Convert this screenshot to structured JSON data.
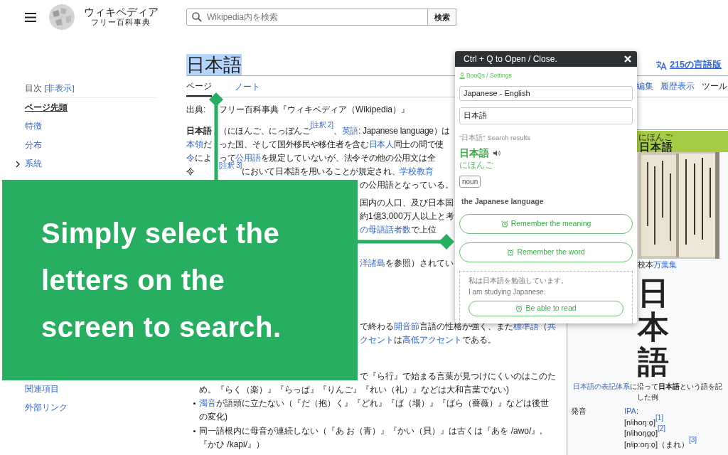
{
  "header": {
    "wordmark": "ウィキペディア",
    "tagline": "フリー百科事典",
    "search": {
      "placeholder": "Wikipedia内を検索"
    },
    "search_button": "検索"
  },
  "toc": {
    "title": "目次",
    "toggle": "[非表示]",
    "items": [
      {
        "label": "ページ先頭",
        "selected": true,
        "expandable": false
      },
      {
        "label": "特徴",
        "selected": false,
        "expandable": false
      },
      {
        "label": "分布",
        "selected": false,
        "expandable": false
      },
      {
        "label": "系統",
        "selected": false,
        "expandable": true
      }
    ],
    "more_items": [
      {
        "label": "関連項目",
        "selected": false,
        "expandable": false
      },
      {
        "label": "外部リンク",
        "selected": false,
        "expandable": false
      }
    ]
  },
  "article": {
    "title": "日本語",
    "title_highlighted": true,
    "languages": "215の言語版",
    "tabs": [
      {
        "label": "ページ",
        "selected": true
      },
      {
        "label": "ノート",
        "selected": false
      }
    ],
    "actions": [
      "編集",
      "履歴表示",
      "ツール"
    ],
    "source": {
      "left": "出典:",
      "right": "フリー百科事典『ウィキペディア（Wikipedia）』"
    },
    "intro_lines": [
      {
        "left": [
          {
            "text": "日本語",
            "kind": "bold"
          }
        ],
        "right": [
          {
            "text": "（にほんご、にっぽんご",
            "kind": "plain"
          },
          {
            "text": "[注釈 2]",
            "kind": "ref"
          },
          {
            "text": "、",
            "kind": "plain"
          },
          {
            "text": "英語",
            "kind": "link"
          },
          {
            "text": ": Japanese language）は",
            "kind": "plain"
          }
        ]
      },
      {
        "left": [
          {
            "text": "本領",
            "kind": "link"
          },
          {
            "text": "だ",
            "kind": "plain"
          }
        ],
        "right": [
          {
            "text": "った国、そして国外移民や移住者を含む",
            "kind": "plain"
          },
          {
            "text": "日本人",
            "kind": "link"
          },
          {
            "text": "同士の間で使",
            "kind": "plain"
          }
        ]
      },
      {
        "left": [
          {
            "text": "令",
            "kind": "link"
          },
          {
            "text": "によ",
            "kind": "plain"
          }
        ],
        "right": [
          {
            "text": "って",
            "kind": "plain"
          },
          {
            "text": "公用語",
            "kind": "link"
          },
          {
            "text": "を規定していないが、法令その他の公用文は全",
            "kind": "plain"
          }
        ]
      },
      {
        "left": [
          {
            "text": "令",
            "kind": "plain"
          }
        ],
        "right": [
          {
            "text": "[注釈 3]",
            "kind": "ref"
          },
          {
            "text": "において日本語を用いることが規定され、",
            "kind": "plain"
          },
          {
            "text": "学校教育",
            "kind": "link"
          }
        ]
      }
    ],
    "beside_paragraphs": [
      [
        [
          {
            "text": "の公用語となっている。",
            "kind": "plain"
          }
        ]
      ],
      [
        [
          {
            "text": "国内の人口、及び日本国",
            "kind": "plain"
          }
        ],
        [
          {
            "text": "約1億3,000万人以上と考",
            "kind": "plain"
          }
        ],
        [
          {
            "text": "の母語話者数",
            "kind": "link"
          },
          {
            "text": "で上位",
            "kind": "plain"
          }
        ]
      ],
      [
        [
          {
            "text": "洋諸島",
            "kind": "link"
          },
          {
            "text": "を参照）されてい",
            "kind": "plain"
          }
        ]
      ]
    ],
    "below_lines": [
      [
        {
          "text": "で終わる",
          "kind": "plain"
        },
        {
          "text": "開音節",
          "kind": "link"
        },
        {
          "text": "言語の性格が強く、また",
          "kind": "plain"
        },
        {
          "text": "標準語",
          "kind": "link"
        },
        {
          "text": "（",
          "kind": "plain"
        },
        {
          "text": "共",
          "kind": "link"
        }
      ],
      [
        {
          "text": "クセント",
          "kind": "link"
        },
        {
          "text": "は",
          "kind": "plain"
        },
        {
          "text": "高低アクセント",
          "kind": "link"
        },
        {
          "text": "である。",
          "kind": "plain"
        }
      ]
    ],
    "list_fragment": {
      "beside": [
        {
          "text": "で『ら行』で始まる言葉が見つけにくいのはこのた",
          "kind": "plain"
        }
      ],
      "rest": [
        {
          "text": "め。『らく（楽）』『らっぱ』『りんご』『れい（礼）』などは大和言葉でない)",
          "kind": "plain"
        }
      ]
    },
    "list_items": [
      [
        {
          "text": "濁音",
          "kind": "link"
        },
        {
          "text": "が語頭に立たない（『だ（抱）く』『どれ』『ば（場）』『ばら（薔薇）』などは後世の変化)",
          "kind": "plain"
        }
      ],
      [
        {
          "text": "同一語根内に母音が連続しない（『あ お（青）』『かい（貝）』は古くは『あを /awo/』, 『かひ /kapi/』）",
          "kind": "plain"
        }
      ]
    ]
  },
  "infobox": {
    "title": "日本語",
    "reading": "にほんご",
    "kind": "picture",
    "picture_caption": [
      {
        "text": "校本",
        "kind": "plain"
      },
      {
        "text": "万葉集",
        "kind": "link"
      }
    ],
    "calligraphy": "日本語",
    "caption_lines": [
      [
        {
          "text": "日本語の表記体系",
          "kind": "link"
        },
        {
          "text": "に沿って",
          "kind": "plain"
        },
        {
          "text": "日本語",
          "kind": "bold"
        },
        {
          "text": "という語を記",
          "kind": "plain"
        }
      ],
      [
        {
          "text": "した例",
          "kind": "plain"
        }
      ]
    ],
    "rows": [
      {
        "label": "発音",
        "values": [
          [
            {
              "text": "IPA",
              "kind": "link"
            },
            {
              "text": ":",
              "kind": "plain"
            }
          ],
          [
            {
              "text": "[nʲihoŋːo̞]",
              "kind": "plain"
            },
            {
              "text": "[1]",
              "kind": "ref"
            }
          ],
          [
            {
              "text": "[nʲihoŋgo̞]",
              "kind": "plain"
            },
            {
              "text": "[2]",
              "kind": "ref"
            }
          ],
          [
            {
              "text": "[nʲipːoŋːo̞]（まれ）",
              "kind": "plain"
            },
            {
              "text": "[3]",
              "kind": "ref"
            }
          ]
        ]
      }
    ]
  },
  "popup": {
    "title": "Ctrl + Q to Open / Close.",
    "account": "BooQs / Settings",
    "language_pair": "Japanese - English",
    "query": "日本語",
    "results_label": "\"日本語\" Search results",
    "entries": [
      {
        "word": "日本語",
        "reading": "にほんご",
        "part_of_speech": "noun",
        "meaning": "the Japanese language"
      }
    ],
    "buttons": [
      "Remember the meaning",
      "Remember the word"
    ],
    "example": {
      "sentence": "私は日本語を勉強しています。",
      "translation": "I am studying Japanese.",
      "button": "Be able to read"
    }
  },
  "banner": {
    "text": "Simply select the letters on the screen to search."
  }
}
